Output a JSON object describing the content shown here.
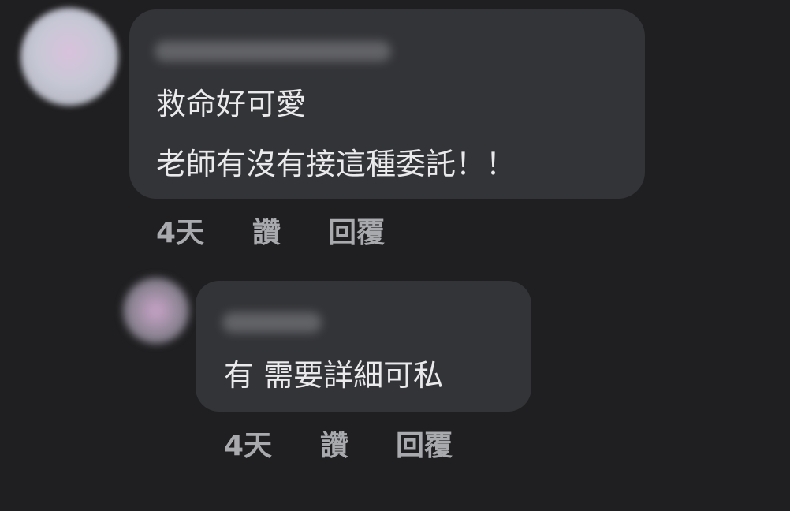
{
  "comments": [
    {
      "lines": [
        "救命好可愛",
        "老師有沒有接這種委託！！"
      ],
      "time": "4天",
      "like_label": "讚",
      "reply_label": "回覆"
    },
    {
      "lines": [
        "有 需要詳細可私"
      ],
      "time": "4天",
      "like_label": "讚",
      "reply_label": "回覆"
    }
  ]
}
